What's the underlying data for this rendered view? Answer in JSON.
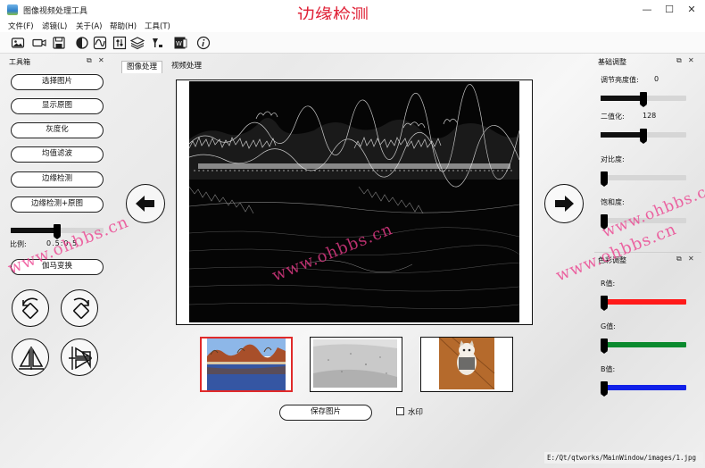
{
  "window": {
    "title": "图像视频处理工具",
    "heading": "边缘检测",
    "controls": [
      "—",
      "☐",
      "✕"
    ]
  },
  "menu": [
    {
      "label": "文件(F)"
    },
    {
      "label": "滤镜(L)"
    },
    {
      "label": "关于(A)"
    },
    {
      "label": "帮助(H)"
    },
    {
      "label": "工具(T)"
    }
  ],
  "toolbox": {
    "title": "工具箱",
    "buttons": [
      "选择图片",
      "显示原图",
      "灰度化",
      "均值滤波",
      "边缘检测",
      "边缘检测+原图"
    ],
    "ratio_label": "比例:",
    "ratio_value": "0.5:0.5",
    "ratio_slider": 0.5,
    "gamma_button": "伽马变换",
    "dock_float": "⧉",
    "dock_close": "✕"
  },
  "tabs": [
    {
      "label": "图像处理",
      "active": true
    },
    {
      "label": "视频处理",
      "active": false
    }
  ],
  "bottom": {
    "save_button": "保存图片",
    "watermark_checkbox": "水印",
    "watermark_checked": false,
    "status_path": "E:/Qt/qtworks/MainWindow/images/1.jpg"
  },
  "basic_adjust": {
    "title": "基础调整",
    "brightness_label": "调节亮度值:",
    "brightness_value": "0",
    "brightness_slider": 0.5,
    "binarize_label": "二值化:",
    "binarize_value": "128",
    "binarize_slider": 0.5,
    "contrast_label": "对比度:",
    "contrast_slider": 0.0,
    "saturation_label": "饱和度:",
    "saturation_slider": 0.0
  },
  "color_adjust": {
    "title": "色彩调整",
    "r_label": "R值:",
    "g_label": "G值:",
    "b_label": "B值:",
    "r_slider": 0.0,
    "g_slider": 0.0,
    "b_slider": 0.0,
    "colors": {
      "r": "#ff1a1a",
      "g": "#0b8a2e",
      "b": "#1020e8"
    }
  },
  "watermarks": [
    "www.ohbbs.cn",
    "www.ohbbs.cn",
    "www.ohbbs.cn",
    "www.ohbbs.cn"
  ],
  "icons": [
    "image-icon",
    "video-icon",
    "save-icon",
    "contrast-icon",
    "curve-icon",
    "adjust-icon",
    "layers-icon",
    "filter-icon",
    "text-icon",
    "info-icon"
  ]
}
